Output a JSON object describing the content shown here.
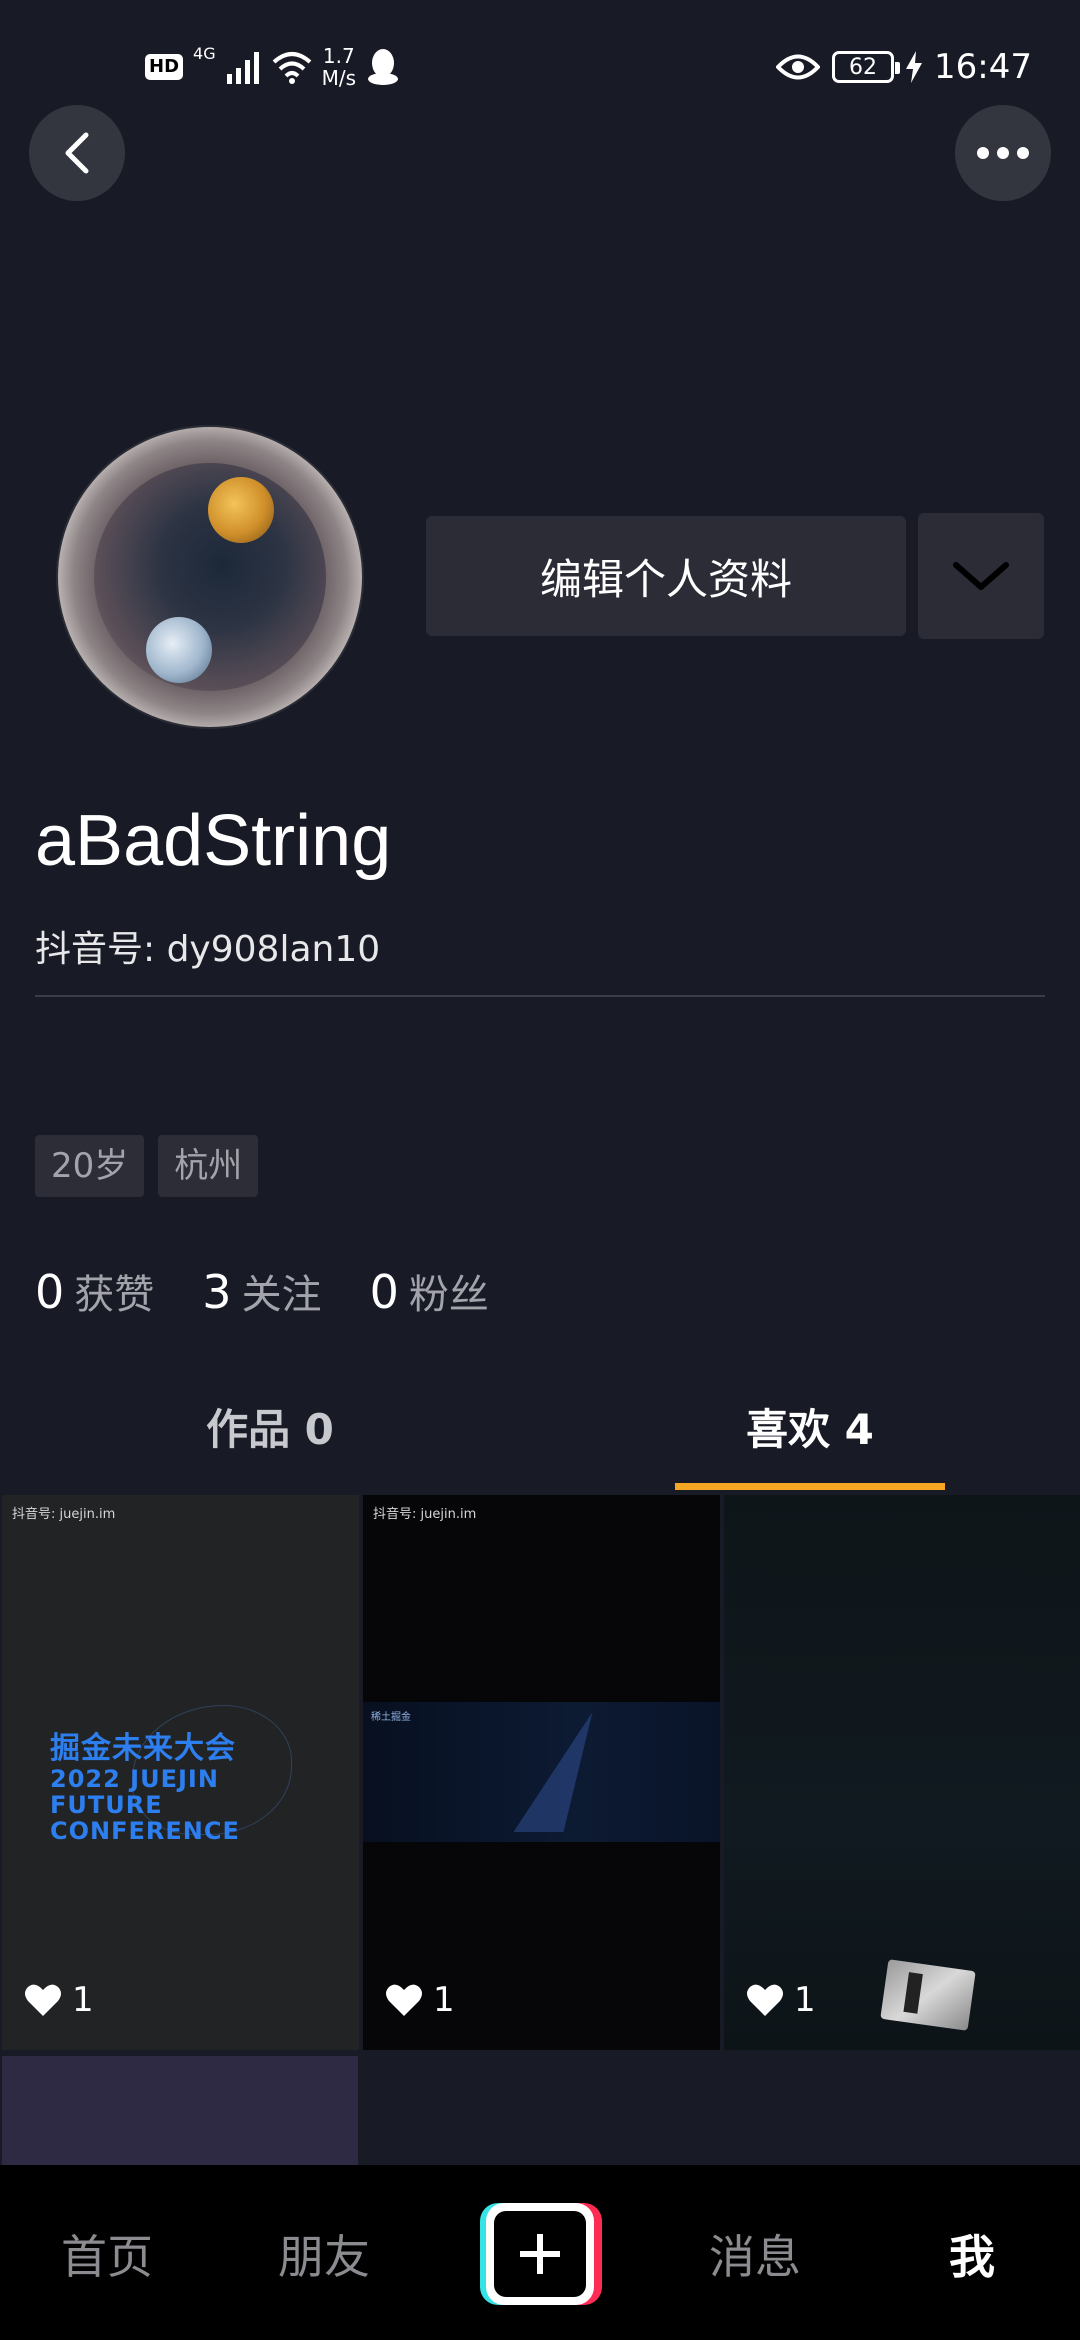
{
  "status_bar": {
    "hd": "HD",
    "network": "4G",
    "speed_value": "1.7",
    "speed_unit": "M/s",
    "battery": "62",
    "time": "16:47"
  },
  "profile": {
    "edit_label": "编辑个人资料",
    "username": "aBadString",
    "douyin_id": "抖音号: dy908lan10",
    "tags": [
      "20岁",
      "杭州"
    ],
    "stats": [
      {
        "value": "0",
        "label": "获赞"
      },
      {
        "value": "3",
        "label": "关注"
      },
      {
        "value": "0",
        "label": "粉丝"
      }
    ]
  },
  "tabs": {
    "works": "作品 0",
    "likes": "喜欢 4",
    "active": "likes"
  },
  "grid": {
    "items": [
      {
        "watermark": "抖音号: juejin.im",
        "title": "掘金未来大会",
        "lines": [
          "2022 JUEJIN",
          "FUTURE",
          "CONFERENCE"
        ],
        "likes": "1"
      },
      {
        "watermark": "抖音号: juejin.im",
        "stage_label": "稀土掘金",
        "likes": "1"
      },
      {
        "likes": "1"
      }
    ]
  },
  "bottom_nav": {
    "home": "首页",
    "friends": "朋友",
    "messages": "消息",
    "me": "我"
  },
  "colors": {
    "accent": "#f5a623",
    "background": "#181a25",
    "button": "#2b2c36"
  }
}
